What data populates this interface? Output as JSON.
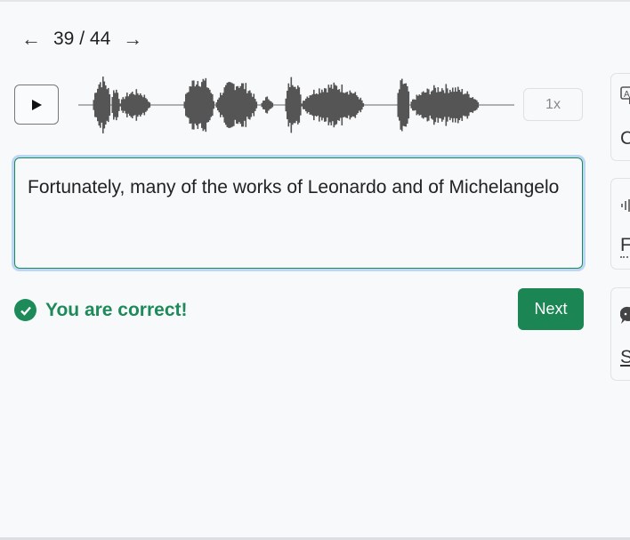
{
  "nav": {
    "prev_icon": "arrow-left-icon",
    "next_icon": "arrow-right-icon",
    "current": "39",
    "separator": "/",
    "total": "44"
  },
  "player": {
    "play_icon": "play-icon",
    "speed": "1x"
  },
  "answer": {
    "text": "Fortunately, many of the works of Leonardo and of Michelangelo"
  },
  "feedback": {
    "message": "You are correct!",
    "icon": "check-circle-icon"
  },
  "next_label": "Next",
  "side_cards": [
    {
      "icon": "translate-icon",
      "text": "C"
    },
    {
      "icon": "audio-wave-icon",
      "text": "F"
    },
    {
      "icon": "chat-bubble-icon",
      "text": "S"
    }
  ],
  "colors": {
    "success": "#1d8a5a",
    "focus_ring": "#bcd6f5"
  }
}
